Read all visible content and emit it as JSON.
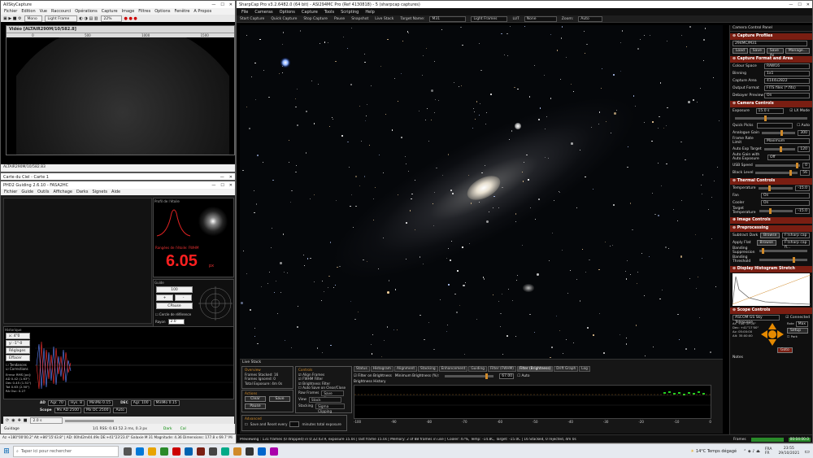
{
  "allsky": {
    "title": "AllSkyCapture",
    "menu": [
      "Fichier",
      "Edition",
      "Vue",
      "Raccourci",
      "Opérations",
      "Capture",
      "Image",
      "Filtres",
      "Options",
      "Fenêtre",
      "A Propos"
    ],
    "mode": "Mono",
    "frame": "Light Frame",
    "zoom": "22%",
    "subwin_title": "Vidéo [ALTAIR290M/10/582.8]",
    "status": "ALTAIR290M/10/582.83"
  },
  "phd": {
    "title": "PHD2 Guiding 2.6.10 - FASA2HC",
    "menu": [
      "Fichier",
      "Guide",
      "Outils",
      "Affichage",
      "Darks",
      "Signets",
      "Aide"
    ],
    "back_title": "Carte du Ciel - Carte 1",
    "star_profile_title": "Profil de l'étoile",
    "star_hfd_label": "Rangées de l'étoile: FWHM",
    "star_value": "6.05",
    "star_unit": "px",
    "guide_label": "Guide",
    "guide_values": [
      "100",
      "+",
      "-"
    ],
    "guide_stop": "CPause",
    "ref_circle": "Cercle de référence",
    "radius_label": "Rayon",
    "radius_value": "2.0",
    "graph_title": "Historique",
    "graph_side_top": "x: 4\"0",
    "graph_side_y": "y: -1\"-0",
    "graph_side_btn": "Réglages",
    "graph_clear": "Effacer",
    "graph_checks": [
      "Tendances",
      "Corrections"
    ],
    "graph_stats": [
      "Erreur RMS [px]:",
      "AD 0.42 (1.63\")",
      "Dec 0.45 (1.51\")",
      "Tot 0.63 (2.50\")",
      "RA Osc: 0.27"
    ],
    "ad_label": "AD",
    "ad_values": [
      "Agr. 70",
      "Hys. 8",
      "MinMo 0.15"
    ],
    "dec_label": "DEC",
    "dec_values": [
      "Agr. 100",
      "MinMo 0.15"
    ],
    "scope_label": "Scope",
    "scope_values": [
      "Mx AD 2500",
      "Mx DC 2500",
      "Auto"
    ],
    "exposure": "2.0 s",
    "status_left": "Guidage",
    "status_mid": "1/1  RSS: 0.63  52.3 ms, 0.3 px",
    "status_dark": "Dark",
    "status_cal": "Cal"
  },
  "sharpcap": {
    "title": "SharpCap Pro v3.2.6482.0 (64 bit) - ASI294MC Pro (Ref 4130818) - 5 (sharpcap captures)",
    "menu": [
      "File",
      "Cameras",
      "Options",
      "Capture",
      "Tools",
      "Scripting",
      "Help"
    ],
    "toolbar": [
      "Start Capture",
      "Quick Capture",
      "Stop Capture",
      "Pause",
      "Snapshot",
      "Live Stack"
    ],
    "target_label": "Target Name:",
    "target_value": "M31",
    "frame_type": "Light Frames",
    "lut_label": "LUT",
    "lut_value": "None",
    "zoom_label": "Zoom:",
    "zoom_value": "Auto"
  },
  "live_stack": {
    "title": "Live Stack",
    "overview_label": "Overview",
    "frames_stacked": "Frames Stacked: 16",
    "frames_ignored": "Frames Ignored: 0",
    "total_exposure": "Total Exposure: 4m 0s",
    "actions_label": "Actions",
    "clear": "Clear",
    "save": "Save",
    "pause": "Pause",
    "controls_label": "Controls",
    "checks": [
      "Align Frames",
      "FWHM Filter",
      "Brightness Filter",
      "Auto Save on Clear/Close"
    ],
    "raw_frames": "Raw Frames",
    "raw_value": "Save None",
    "view_label": "View",
    "view_value": "Stack",
    "stacking_label": "Stacking",
    "stacking_value": "Sigma Clipping",
    "advanced_label": "Advanced",
    "save_reset": "Save and Reset every",
    "minutes": "minutes total exposure",
    "tabs": [
      "Status",
      "Histogram",
      "Alignment",
      "Stacking",
      "Enhancement",
      "Guiding",
      "Filter (FWHM)",
      "Filter (Brightness)",
      "Drift Graph",
      "Log"
    ],
    "filter_checkbox": "Filter on Brightness",
    "min_brightness": "Minimum Brightness (%):",
    "min_value": "67.00",
    "auto": "Auto",
    "brightness_history": "Brightness History",
    "axis_ticks": [
      "-100",
      "-90",
      "-80",
      "-70",
      "-60",
      "-50",
      "-40",
      "-30",
      "-20",
      "-10",
      "0"
    ]
  },
  "panel": {
    "title": "Camera Control Panel",
    "capture_profiles": "Capture Profiles",
    "profile_value": "294MC/M31",
    "profile_btns": [
      "Load",
      "Save",
      "Save As",
      "Manage..."
    ],
    "capture_format": "Capture Format and Area",
    "format_rows": [
      {
        "label": "Colour Space",
        "value": "RAW16"
      },
      {
        "label": "Binning",
        "value": "1x1"
      },
      {
        "label": "Capture Area",
        "value": "4144x2822"
      },
      {
        "label": "Output Format",
        "value": "FITS files (*.fits)"
      },
      {
        "label": "Debayer Preview",
        "value": "On"
      }
    ],
    "camera_controls": "Camera Controls",
    "exposure_label": "Exposure",
    "exposure_value": "15.0 s",
    "lx_mode": "LX Mode",
    "quick_picks": "Quick Picks",
    "auto": "Auto",
    "analogue_gain": "Analogue Gain",
    "gain_value": "300",
    "frame_rate": "Frame Rate Limit",
    "frame_rate_value": "Maximum",
    "auto_exp_target": "Auto Exp Target",
    "auto_exp_value": "120",
    "auto_gain": "Auto Gain with Auto Exposure",
    "auto_gain_value": "Off",
    "usb_speed": "USB Speed",
    "usb_value": "0",
    "black_level": "Black Level",
    "black_value": "56",
    "thermal": "Thermal Controls",
    "temperature": "Temperature",
    "temp_value": "-15.0",
    "fan": "Fan",
    "fan_value": "On",
    "cooler": "Cooler",
    "cooler_value": "On",
    "target_temp": "Target Temperature",
    "target_temp_value": "-15.0",
    "image_controls": "Image Controls",
    "preprocessing": "Preprocessing",
    "subtract_dark": "Subtract Dark",
    "apply_flat": "Apply Flat",
    "browse": "Browse",
    "dark_file": "F:\\sharp cap d...",
    "flat_file": "F:\\sharp cap fl...",
    "banding_supp": "Banding Suppression",
    "banding_thresh": "Banding Threshold",
    "display_hist": "Display Histogram Stretch",
    "scope_controls": "Scope Controls",
    "ascom": "ASCOM GS Sky Telescope",
    "connected": "Connected",
    "ra_dec": [
      "Ar: +06°37'00\"",
      "Dec: +41°17'00\"",
      "Az: 05:00:00",
      "Alt: 35:00:00"
    ],
    "rate": "Rate",
    "rate_value": "Max",
    "setup": "Setup",
    "park": "Park",
    "goto": "Goto",
    "notes": "Notes"
  },
  "sc_status": {
    "frames_label": "Frames",
    "time": "00:04:00.0",
    "text": "Previewing : 131 frames (0 dropped) in 0:32:43.9, exposure 15.0s  | last frame 15.0s | Memory: 2 of 88 frames in use  | Cooler: 47%, Temp: -14.8C, Target: -15.0C | 16 Stacked, 0 rejected, 4m 0s"
  },
  "bottom_status": "Az +180°00'00.2\" Alt +86°15'43.8\"  |  AD: 00h42m44.49s DE:+41°23'23.0\"  Galaxie M 31  Magnitude: 4.36  Dimensions: 177.8 x 69.7'  Mi",
  "taskbar": {
    "search_placeholder": "Taper ici pour rechercher",
    "weather": "14°C  Temps dégagé",
    "lang": "FRA\nFR",
    "time": "23:55",
    "date": "29/10/2021"
  },
  "colors": {
    "accent": "#7a1e12",
    "orange": "#d08a2a",
    "phd_red": "#ff2020"
  }
}
